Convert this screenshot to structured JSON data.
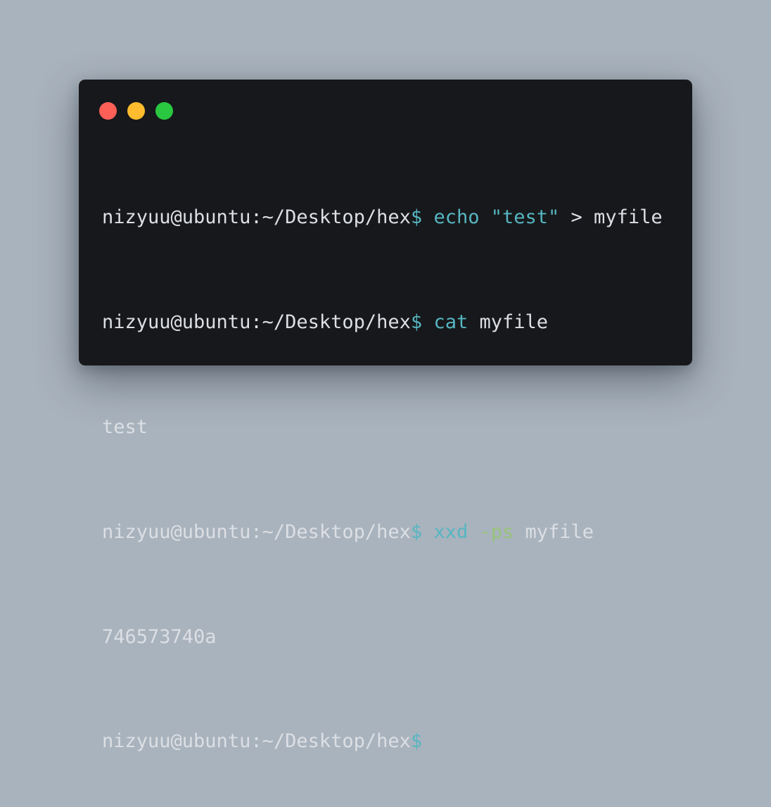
{
  "window": {
    "controls": [
      "close",
      "minimize",
      "maximize"
    ],
    "colors": {
      "close": "#fe5f57",
      "minimize": "#febc2e",
      "maximize": "#29c840",
      "background": "#17181b",
      "text": "#dcdfe4",
      "command": "#56b6c2",
      "flag": "#98c379"
    }
  },
  "terminal": {
    "prompt": "nizyuu@ubuntu:~/Desktop/hex",
    "prompt_symbol": "$",
    "lines": [
      {
        "type": "command",
        "tokens": [
          "echo",
          "\"test\"",
          "> myfile"
        ]
      },
      {
        "type": "command",
        "tokens": [
          "cat",
          "myfile"
        ]
      },
      {
        "type": "output",
        "text": "test"
      },
      {
        "type": "command",
        "tokens": [
          "xxd",
          "-ps",
          "myfile"
        ]
      },
      {
        "type": "output",
        "text": "746573740a"
      },
      {
        "type": "prompt"
      }
    ]
  }
}
